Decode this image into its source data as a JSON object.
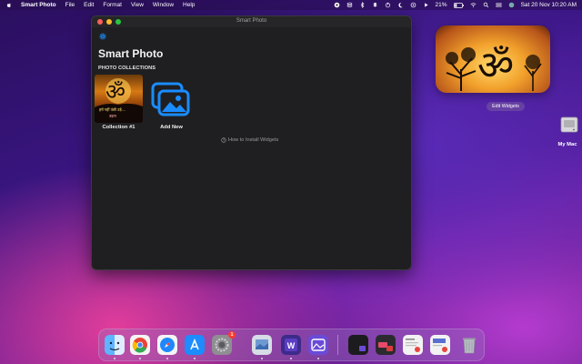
{
  "menubar": {
    "app_name": "Smart Photo",
    "menus": [
      "File",
      "Edit",
      "Format",
      "View",
      "Window",
      "Help"
    ],
    "battery": "21%",
    "datetime": "Sat 20 Nov  10:20 AM"
  },
  "window": {
    "title": "Smart Photo",
    "app_title": "Smart Photo",
    "section_label": "PHOTO COLLECTIONS",
    "collections": [
      {
        "label": "Collection #1",
        "caption_top": "हर्ष नहीं पंछी उड़े....",
        "caption_bottom": "उड़ान"
      }
    ],
    "add_new_label": "Add New",
    "help_link": "How to Install Widgets"
  },
  "widget": {
    "edit_label": "Edit Widgets"
  },
  "desktop": {
    "disk_label": "My Mac"
  },
  "dock": {
    "items": [
      "finder",
      "chrome",
      "safari",
      "app-store",
      "system-preferences",
      "preview",
      "word-app",
      "screen-capture",
      "window-1",
      "window-2",
      "window-3",
      "window-4",
      "trash"
    ],
    "system_preferences_badge": "1"
  },
  "colors": {
    "accent": "#1a8cff",
    "window_bg": "#1f1f21"
  }
}
